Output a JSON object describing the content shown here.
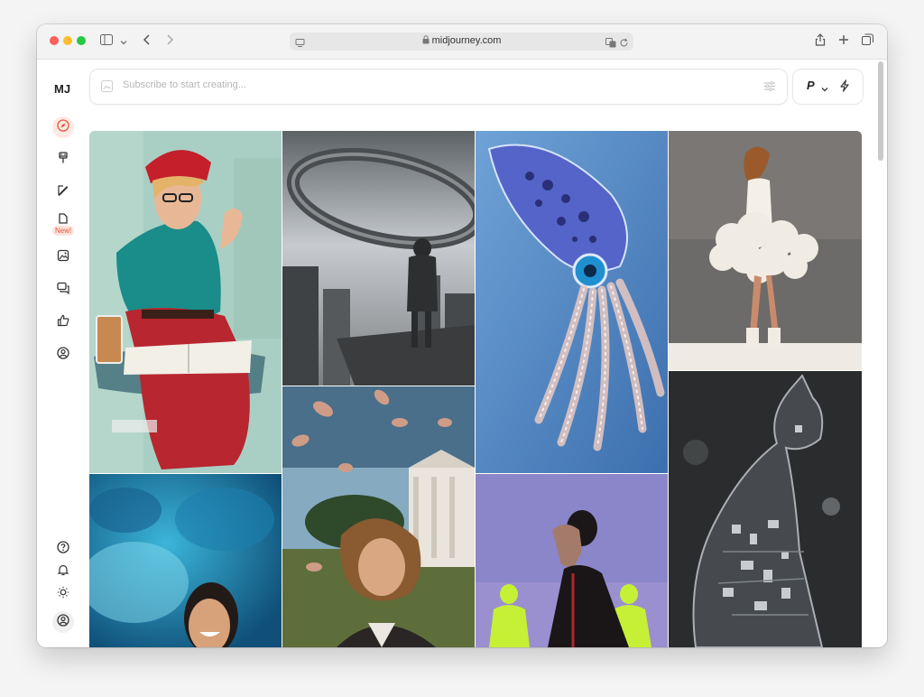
{
  "browser": {
    "url": "midjourney.com",
    "icons": [
      "sidebar-toggle-icon",
      "chevron-down-icon",
      "back-icon",
      "forward-icon",
      "page-icon",
      "lock-icon",
      "translate-icon",
      "reload-icon",
      "share-icon",
      "new-tab-icon",
      "tabs-overview-icon"
    ]
  },
  "sidebar": {
    "logo": "MJ",
    "items": [
      {
        "name": "explore",
        "icon": "compass-icon",
        "active": true
      },
      {
        "name": "create",
        "icon": "brush-icon"
      },
      {
        "name": "edit",
        "icon": "pencil-icon"
      },
      {
        "name": "personalize",
        "icon": "personalize-icon",
        "badge": "New!"
      },
      {
        "name": "organize",
        "icon": "image-icon"
      },
      {
        "name": "chat",
        "icon": "chat-icon"
      },
      {
        "name": "tasks",
        "icon": "thumbs-up-icon"
      },
      {
        "name": "profile",
        "icon": "profile-icon"
      }
    ],
    "bottom_items": [
      {
        "name": "help",
        "icon": "help-icon"
      },
      {
        "name": "notifications",
        "icon": "bell-icon"
      },
      {
        "name": "theme",
        "icon": "sun-icon"
      },
      {
        "name": "account",
        "icon": "account-icon"
      }
    ]
  },
  "prompt_bar": {
    "placeholder": "Subscribe to start creating...",
    "icons": [
      "image-upload-icon",
      "settings-sliders-icon"
    ]
  },
  "mode": {
    "label": "P",
    "icons": [
      "chevron-down-icon",
      "lightning-icon"
    ]
  },
  "gallery": {
    "images": [
      {
        "name": "woman-red-beret-painting-image"
      },
      {
        "name": "giant-ring-city-image"
      },
      {
        "name": "glass-squid-image"
      },
      {
        "name": "woman-flower-dress-image"
      },
      {
        "name": "cosmic-dust-woman-image"
      },
      {
        "name": "curly-haired-man-image"
      },
      {
        "name": "silhouette-woman-image"
      },
      {
        "name": "glass-cat-robot-image"
      }
    ]
  },
  "colors": {
    "accent": "#e8553a",
    "active_bg": "#ffe9e4"
  }
}
